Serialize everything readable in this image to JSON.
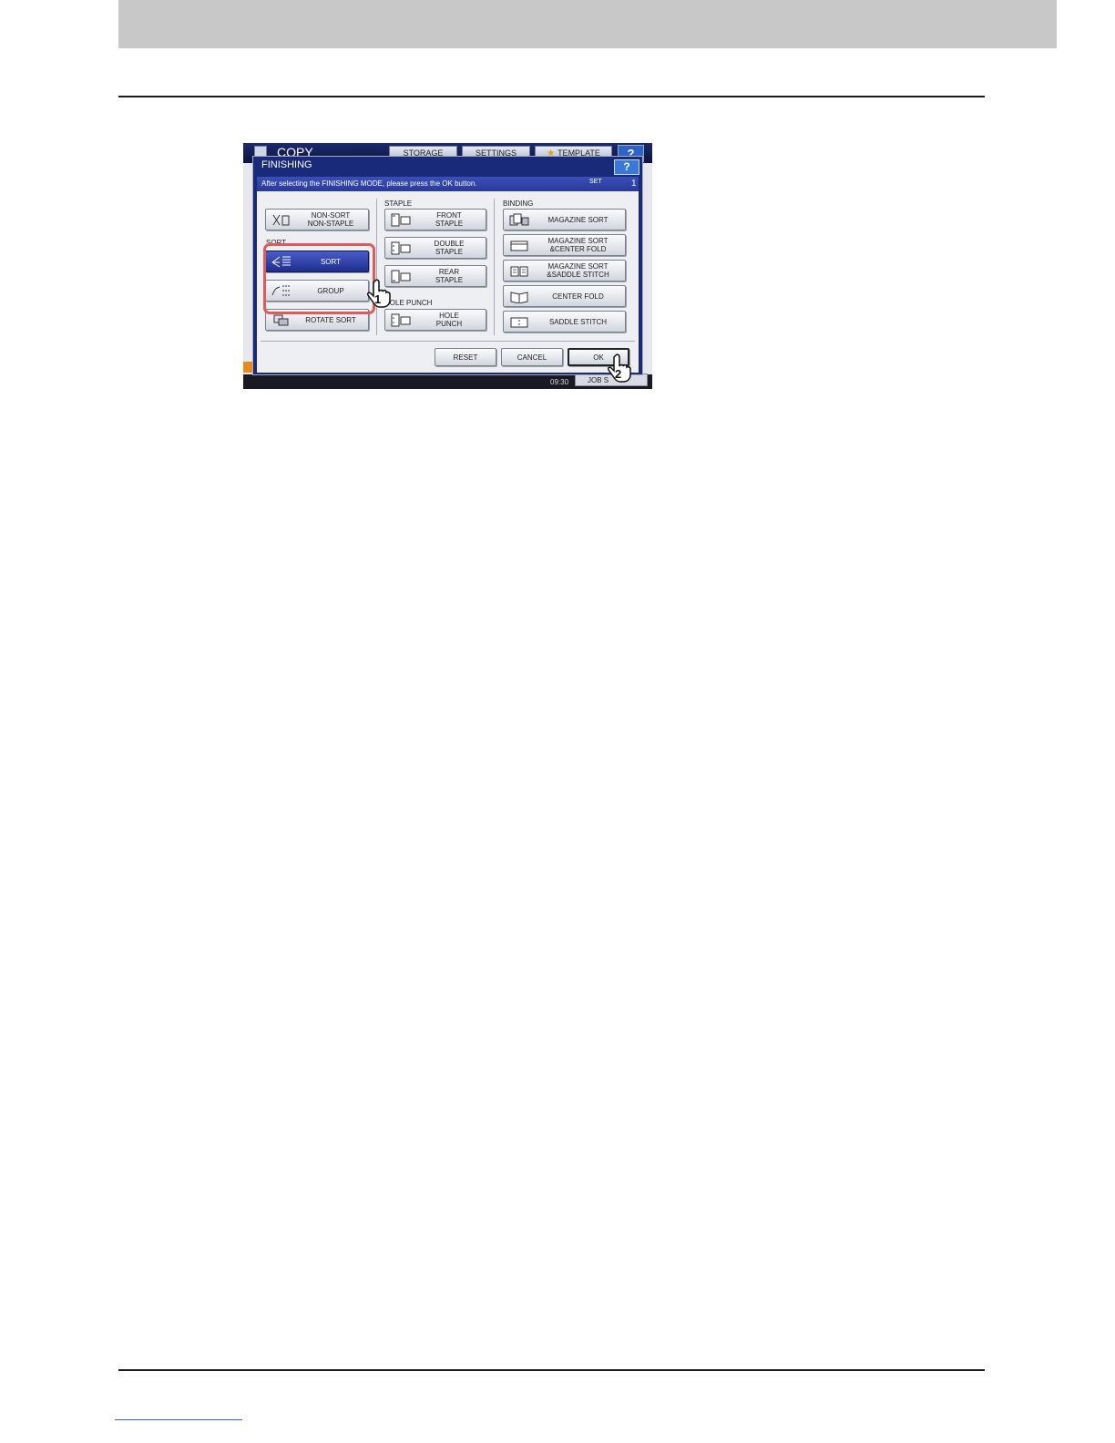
{
  "copy_screen": {
    "title": "COPY",
    "tabs": {
      "storage": "STORAGE",
      "settings": "SETTINGS",
      "template": "TEMPLATE"
    },
    "help": "?",
    "time": "09:30",
    "job_status": "JOB S"
  },
  "dialog": {
    "title": "FINISHING",
    "help": "?",
    "message": "After selecting the FINISHING MODE, please press the OK button.",
    "set_label": "SET",
    "set_value": "1",
    "sections": {
      "sort": "SORT",
      "staple": "STAPLE",
      "hole_punch": "HOLE PUNCH",
      "binding": "BINDING"
    },
    "buttons": {
      "non_sort": [
        "NON-SORT",
        "NON-STAPLE"
      ],
      "sort": "SORT",
      "group": "GROUP",
      "rotate_sort": "ROTATE SORT",
      "front_staple": [
        "FRONT",
        "STAPLE"
      ],
      "double_staple": [
        "DOUBLE",
        "STAPLE"
      ],
      "rear_staple": [
        "REAR",
        "STAPLE"
      ],
      "hole_punch": [
        "HOLE",
        "PUNCH"
      ],
      "magazine_sort": "MAGAZINE SORT",
      "magazine_center_fold": [
        "MAGAZINE SORT",
        "&CENTER FOLD"
      ],
      "magazine_saddle": [
        "MAGAZINE SORT",
        "&SADDLE STITCH"
      ],
      "center_fold": "CENTER FOLD",
      "saddle_stitch": "SADDLE STITCH",
      "reset": "RESET",
      "cancel": "CANCEL",
      "ok": "OK"
    },
    "steps": {
      "one": "1",
      "two": "2"
    }
  }
}
